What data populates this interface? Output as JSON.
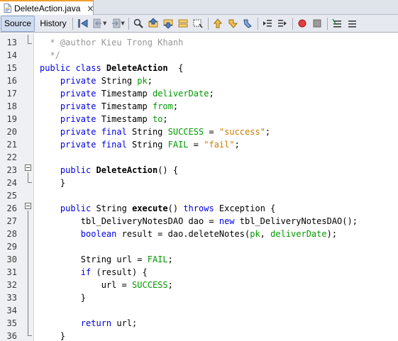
{
  "tab": {
    "filename": "DeleteAction.java",
    "close_glyph": "×"
  },
  "toolbar": {
    "source_label": "Source",
    "history_label": "History",
    "icons": [
      "last-edit-icon",
      "back-icon",
      "forward-icon",
      "find-icon",
      "find-previous-icon",
      "find-next-icon",
      "find-selection-icon",
      "toggle-highlight-icon",
      "previous-bookmark-icon",
      "next-bookmark-icon",
      "toggle-bookmark-icon",
      "shift-left-icon",
      "shift-right-icon",
      "start-macro-icon",
      "stop-macro-icon",
      "comment-icon",
      "uncomment-icon"
    ]
  },
  "colors": {
    "keyword": "#0000e6",
    "field": "#009900",
    "string": "#ce7b00",
    "comment": "#969696",
    "tab_accent": "#f0a030"
  },
  "lines": [
    {
      "n": "13",
      "tokens": [
        [
          "cmt",
          "  * @author Kieu Trong Khanh"
        ]
      ]
    },
    {
      "n": "14",
      "tokens": [
        [
          "cmt",
          "  */"
        ]
      ]
    },
    {
      "n": "15",
      "tokens": [
        [
          "kw",
          "public class "
        ],
        [
          "bold",
          "DeleteAction"
        ],
        [
          "",
          "  {"
        ]
      ]
    },
    {
      "n": "16",
      "tokens": [
        [
          "",
          "    "
        ],
        [
          "kw",
          "private"
        ],
        [
          "",
          " String "
        ],
        [
          "fld",
          "pk"
        ],
        [
          "",
          ";"
        ]
      ]
    },
    {
      "n": "17",
      "tokens": [
        [
          "",
          "    "
        ],
        [
          "kw",
          "private"
        ],
        [
          "",
          " Timestamp "
        ],
        [
          "fld",
          "deliverDate"
        ],
        [
          "",
          ";"
        ]
      ]
    },
    {
      "n": "18",
      "tokens": [
        [
          "",
          "    "
        ],
        [
          "kw",
          "private"
        ],
        [
          "",
          " Timestamp "
        ],
        [
          "fld",
          "from"
        ],
        [
          "",
          ";"
        ]
      ]
    },
    {
      "n": "19",
      "tokens": [
        [
          "",
          "    "
        ],
        [
          "kw",
          "private"
        ],
        [
          "",
          " Timestamp "
        ],
        [
          "fld",
          "to"
        ],
        [
          "",
          ";"
        ]
      ]
    },
    {
      "n": "20",
      "tokens": [
        [
          "",
          "    "
        ],
        [
          "kw",
          "private final"
        ],
        [
          "",
          " String "
        ],
        [
          "fld",
          "SUCCESS"
        ],
        [
          "",
          " = "
        ],
        [
          "str",
          "\"success\""
        ],
        [
          "",
          ";"
        ]
      ]
    },
    {
      "n": "21",
      "tokens": [
        [
          "",
          "    "
        ],
        [
          "kw",
          "private final"
        ],
        [
          "",
          " String "
        ],
        [
          "fld",
          "FAIL"
        ],
        [
          "",
          " = "
        ],
        [
          "str",
          "\"fail\""
        ],
        [
          "",
          ";"
        ]
      ]
    },
    {
      "n": "22",
      "tokens": []
    },
    {
      "n": "23",
      "tokens": [
        [
          "",
          "    "
        ],
        [
          "kw",
          "public"
        ],
        [
          "",
          " "
        ],
        [
          "bold",
          "DeleteAction"
        ],
        [
          "",
          "() {"
        ]
      ]
    },
    {
      "n": "24",
      "tokens": [
        [
          "",
          "    }"
        ]
      ]
    },
    {
      "n": "25",
      "tokens": []
    },
    {
      "n": "26",
      "tokens": [
        [
          "",
          "    "
        ],
        [
          "kw",
          "public"
        ],
        [
          "",
          " String "
        ],
        [
          "bold",
          "execute"
        ],
        [
          "",
          "() "
        ],
        [
          "kw",
          "throws"
        ],
        [
          "",
          " Exception {"
        ]
      ]
    },
    {
      "n": "27",
      "tokens": [
        [
          "",
          "        tbl_DeliveryNotesDAO dao = "
        ],
        [
          "kw",
          "new"
        ],
        [
          "",
          " tbl_DeliveryNotesDAO();"
        ]
      ]
    },
    {
      "n": "28",
      "tokens": [
        [
          "",
          "        "
        ],
        [
          "kw",
          "boolean"
        ],
        [
          "",
          " result = dao.deleteNotes("
        ],
        [
          "fld",
          "pk"
        ],
        [
          "",
          ", "
        ],
        [
          "fld",
          "deliverDate"
        ],
        [
          "",
          ");"
        ]
      ]
    },
    {
      "n": "29",
      "tokens": []
    },
    {
      "n": "30",
      "tokens": [
        [
          "",
          "        String url = "
        ],
        [
          "fld",
          "FAIL"
        ],
        [
          "",
          ";"
        ]
      ]
    },
    {
      "n": "31",
      "tokens": [
        [
          "",
          "        "
        ],
        [
          "kw",
          "if"
        ],
        [
          "",
          " (result) {"
        ]
      ]
    },
    {
      "n": "32",
      "tokens": [
        [
          "",
          "            url = "
        ],
        [
          "fld",
          "SUCCESS"
        ],
        [
          "",
          ";"
        ]
      ]
    },
    {
      "n": "33",
      "tokens": [
        [
          "",
          "        }"
        ]
      ]
    },
    {
      "n": "34",
      "tokens": []
    },
    {
      "n": "35",
      "tokens": [
        [
          "",
          "        "
        ],
        [
          "kw",
          "return"
        ],
        [
          "",
          " url;"
        ]
      ]
    },
    {
      "n": "36",
      "tokens": [
        [
          "",
          "    }"
        ]
      ]
    }
  ]
}
